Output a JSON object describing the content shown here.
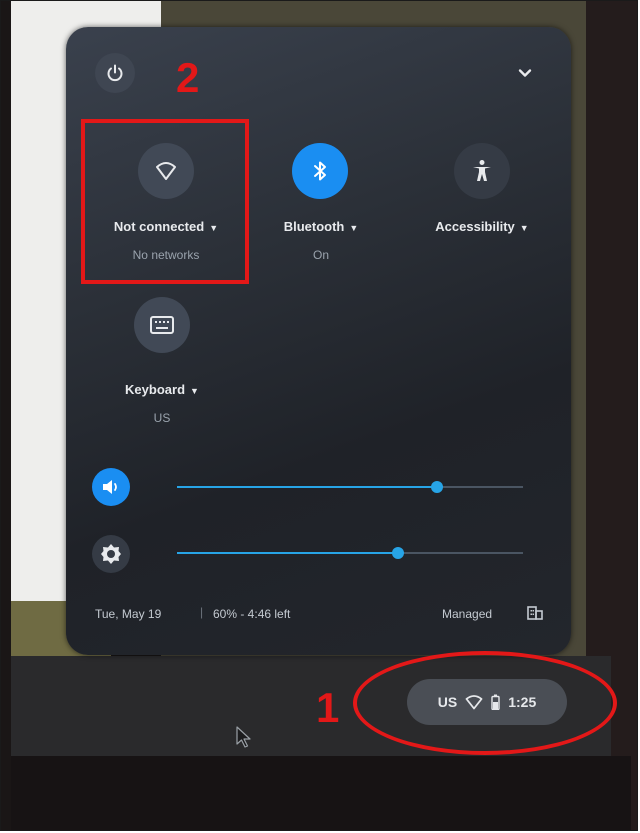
{
  "annotations": {
    "label_one": "1",
    "label_two": "2"
  },
  "tiles": [
    {
      "label": "Not connected",
      "sublabel": "No networks",
      "icon": "wifi-icon",
      "active": false
    },
    {
      "label": "Bluetooth",
      "sublabel": "On",
      "icon": "bluetooth-icon",
      "active": true
    },
    {
      "label": "Accessibility",
      "sublabel": "",
      "icon": "accessibility-icon",
      "active": false
    },
    {
      "label": "Keyboard",
      "sublabel": "US",
      "icon": "keyboard-icon",
      "active": false
    }
  ],
  "sliders": {
    "volume": {
      "icon": "volume-icon",
      "level": 0.75
    },
    "brightness": {
      "icon": "brightness-icon",
      "level": 0.64
    }
  },
  "footer": {
    "date": "Tue, May 19",
    "battery": "60% - 4:46 left",
    "managed": "Managed"
  },
  "shelf_status": {
    "input_method": "US",
    "time": "1:25"
  },
  "colors": {
    "accent": "#1a8ef2",
    "slider": "#27a4e6",
    "annotation": "#e31818"
  }
}
